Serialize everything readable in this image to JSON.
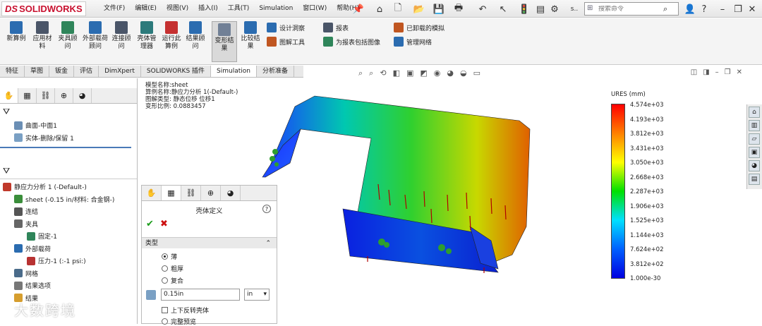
{
  "app": {
    "logo": "SOLIDWORKS",
    "logo_mark": "DS"
  },
  "menus": [
    "文件(F)",
    "编辑(E)",
    "视图(V)",
    "插入(I)",
    "工具(T)",
    "Simulation",
    "窗口(W)",
    "帮助(H)"
  ],
  "search": {
    "placeholder": "搜索命令"
  },
  "ribbon": {
    "buttons": [
      {
        "label": "新算例",
        "color": "#2b6cb0"
      },
      {
        "label": "应用材料",
        "color": "#4a5568"
      },
      {
        "label": "夹具顾问",
        "color": "#2f855a"
      },
      {
        "label": "外部载荷顾问",
        "color": "#2b6cb0"
      },
      {
        "label": "连接顾问",
        "color": "#4a5568"
      },
      {
        "label": "壳体管理器",
        "color": "#2c7a7b"
      },
      {
        "label": "运行此算例",
        "color": "#c53030"
      },
      {
        "label": "结果顾问",
        "color": "#2b6cb0"
      },
      {
        "label": "变形结果",
        "color": "#718096"
      },
      {
        "label": "比较结果",
        "color": "#2b6cb0"
      }
    ],
    "small": [
      {
        "label": "设计洞察",
        "color": "#2b6cb0"
      },
      {
        "label": "图解工具",
        "color": "#c05621"
      },
      {
        "label": "报表",
        "color": "#4a5568"
      },
      {
        "label": "为报表包括图像",
        "color": "#2f855a"
      },
      {
        "label": "已卸载的模拟",
        "color": "#c05621"
      },
      {
        "label": "管理网络",
        "color": "#2b6cb0"
      }
    ]
  },
  "tabs": [
    "特征",
    "草图",
    "钣金",
    "评估",
    "DimXpert",
    "SOLIDWORKS 插件",
    "Simulation",
    "分析准备"
  ],
  "top_tree": [
    "曲面-中面1",
    "实体-删除/保留 1"
  ],
  "study_tree": [
    "静应力分析 1 (-Default-)",
    "sheet (-0.15 in/材料: 合金钢-)",
    "连结",
    "夹具",
    "固定-1",
    "外部载荷",
    "压力-1 (:-1 psi:)",
    "网格",
    "结果选项",
    "结果"
  ],
  "property_manager": {
    "title": "壳体定义",
    "help": "?",
    "ok": "✔",
    "cancel": "✖",
    "section": "类型",
    "options": [
      "薄",
      "粗厚",
      "复合"
    ],
    "thickness": "0.15in",
    "unit": "in",
    "checks": [
      "上下反转壳体",
      "完整预览"
    ]
  },
  "result_info": [
    "模型名称:sheet",
    "算例名称:静应力分析 1(-Default-)",
    "图解类型: 静态位移 位移1",
    "变形比例: 0.0883457"
  ],
  "legend": {
    "title": "URES (mm)",
    "values": [
      "4.574e+03",
      "4.193e+03",
      "3.812e+03",
      "3.431e+03",
      "3.050e+03",
      "2.668e+03",
      "2.287e+03",
      "1.906e+03",
      "1.525e+03",
      "1.144e+03",
      "7.624e+02",
      "3.812e+02",
      "1.000e-30"
    ]
  },
  "watermark": "大数跨境"
}
